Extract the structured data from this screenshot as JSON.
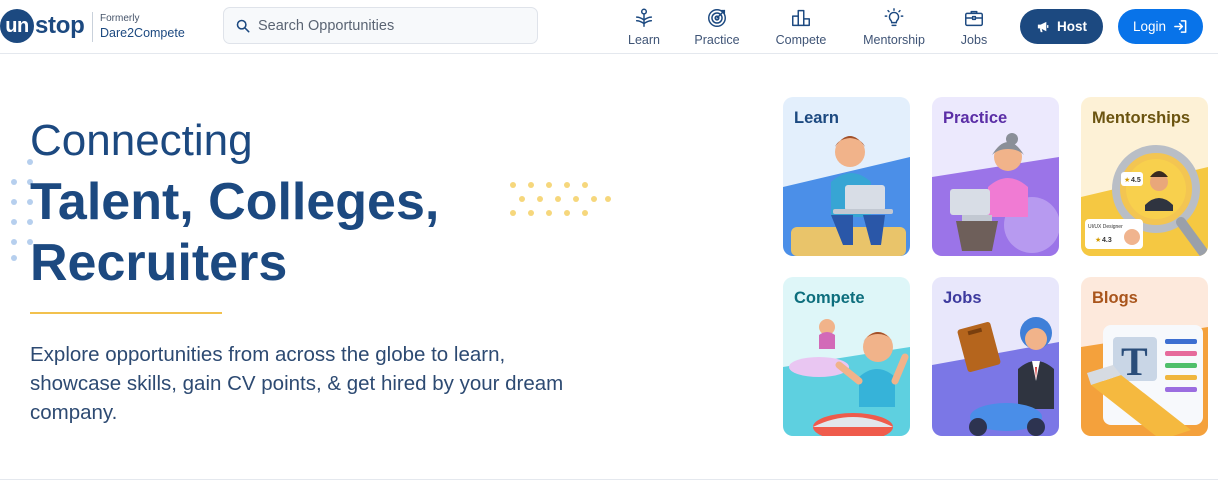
{
  "brand": {
    "logo_circle": "un",
    "logo_rest": "stop",
    "formerly_label": "Formerly",
    "formerly_name": "Dare2Compete"
  },
  "search": {
    "placeholder": "Search Opportunities",
    "icon": "search-icon"
  },
  "nav": {
    "items": [
      {
        "label": "Learn",
        "icon": "learn-icon"
      },
      {
        "label": "Practice",
        "icon": "target-icon"
      },
      {
        "label": "Compete",
        "icon": "podium-icon"
      },
      {
        "label": "Mentorship",
        "icon": "lightbulb-icon"
      },
      {
        "label": "Jobs",
        "icon": "briefcase-icon"
      }
    ],
    "host_label": "Host",
    "login_label": "Login"
  },
  "hero": {
    "line1": "Connecting",
    "line2": "Talent, Colleges,",
    "line3": "Recruiters",
    "description": "Explore opportunities from across the globe to learn, showcase skills, gain CV points, & get hired by your dream company."
  },
  "cards": [
    {
      "title": "Learn",
      "bg": "#e3effc",
      "color": "#1c4980"
    },
    {
      "title": "Practice",
      "bg": "#ece9fd",
      "color": "#5b2ea6"
    },
    {
      "title": "Mentorships",
      "bg": "#fdf1d6",
      "color": "#6b5410"
    },
    {
      "title": "Compete",
      "bg": "#def6f8",
      "color": "#0d6e7d"
    },
    {
      "title": "Jobs",
      "bg": "#e8e7fb",
      "color": "#3d3a9e"
    },
    {
      "title": "Blogs",
      "bg": "#fde9dc",
      "color": "#a9551c"
    }
  ],
  "mentor_badges": {
    "rating_top": "4.5",
    "rating_bottom": "4.3",
    "role": "UI/UX Designer"
  },
  "colors": {
    "primary": "#1c4980",
    "login_blue": "#0873e9",
    "accent_yellow": "#f2c14e"
  }
}
